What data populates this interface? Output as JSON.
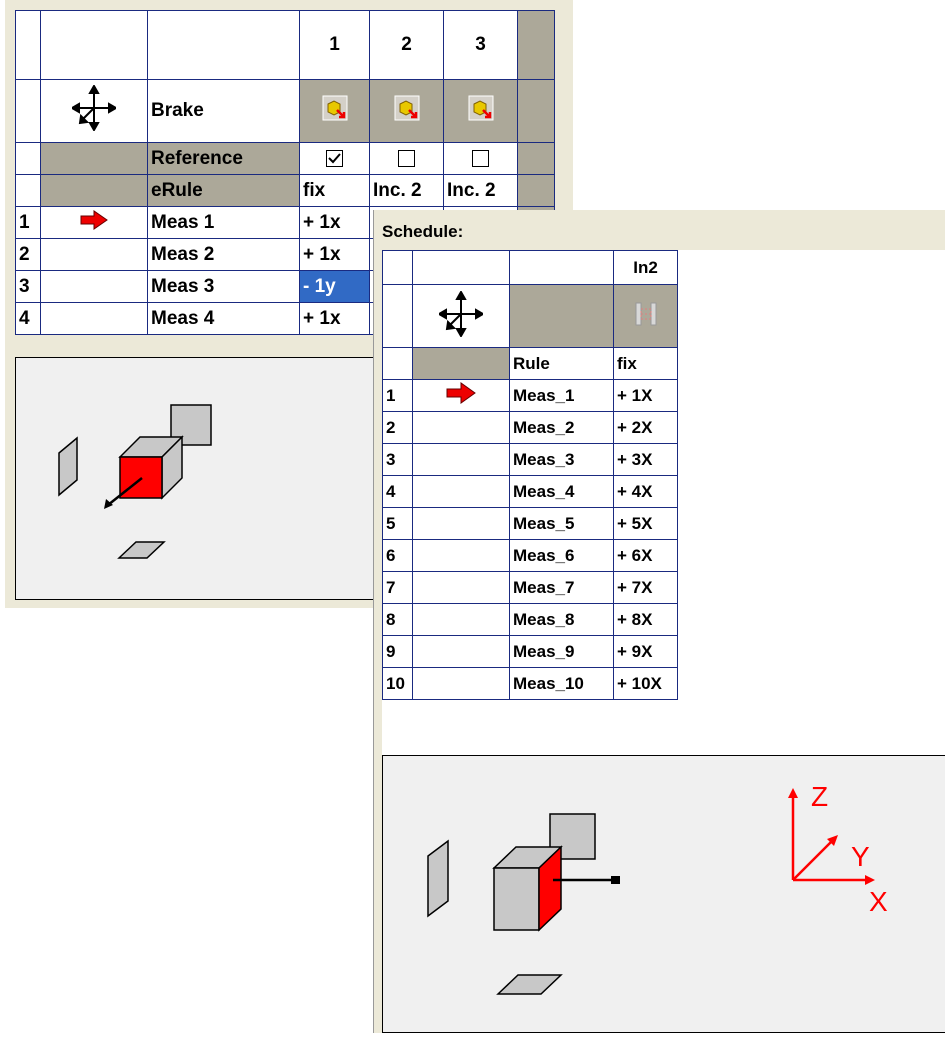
{
  "panel1": {
    "columns": [
      "1",
      "2",
      "3"
    ],
    "brake_label": "Brake",
    "reference_label": "Reference",
    "reference_checked": [
      true,
      false,
      false
    ],
    "erule_label": "eRule",
    "erule_values": [
      "fix",
      "Inc. 2",
      "Inc. 2"
    ],
    "rows": [
      {
        "index": "1",
        "name": "Meas 1",
        "value": "+ 1x",
        "current": true
      },
      {
        "index": "2",
        "name": "Meas 2",
        "value": "+ 1x",
        "current": false
      },
      {
        "index": "3",
        "name": "Meas 3",
        "value": "- 1y",
        "current": false,
        "selected": true
      },
      {
        "index": "4",
        "name": "Meas 4",
        "value": "+ 1x",
        "current": false
      }
    ]
  },
  "panel2": {
    "title": "Schedule:",
    "column": "In2",
    "rule_label": "Rule",
    "rule_value": "fix",
    "rows": [
      {
        "index": "1",
        "name": "Meas_1",
        "value": "+ 1X",
        "current": true
      },
      {
        "index": "2",
        "name": "Meas_2",
        "value": "+ 2X"
      },
      {
        "index": "3",
        "name": "Meas_3",
        "value": "+ 3X"
      },
      {
        "index": "4",
        "name": "Meas_4",
        "value": "+ 4X"
      },
      {
        "index": "5",
        "name": "Meas_5",
        "value": "+ 5X"
      },
      {
        "index": "6",
        "name": "Meas_6",
        "value": "+ 6X"
      },
      {
        "index": "7",
        "name": "Meas_7",
        "value": "+ 7X"
      },
      {
        "index": "8",
        "name": "Meas_8",
        "value": "+ 8X"
      },
      {
        "index": "9",
        "name": "Meas_9",
        "value": "+ 9X"
      },
      {
        "index": "10",
        "name": "Meas_10",
        "value": "+ 10X"
      }
    ],
    "axes": {
      "x": "X",
      "y": "Y",
      "z": "Z"
    }
  },
  "colors": {
    "arrow_red": "#ee0000",
    "grid_border": "#1a2a80",
    "header_gray": "#aca899",
    "selection": "#316ac5",
    "face_red": "#ff0000"
  }
}
